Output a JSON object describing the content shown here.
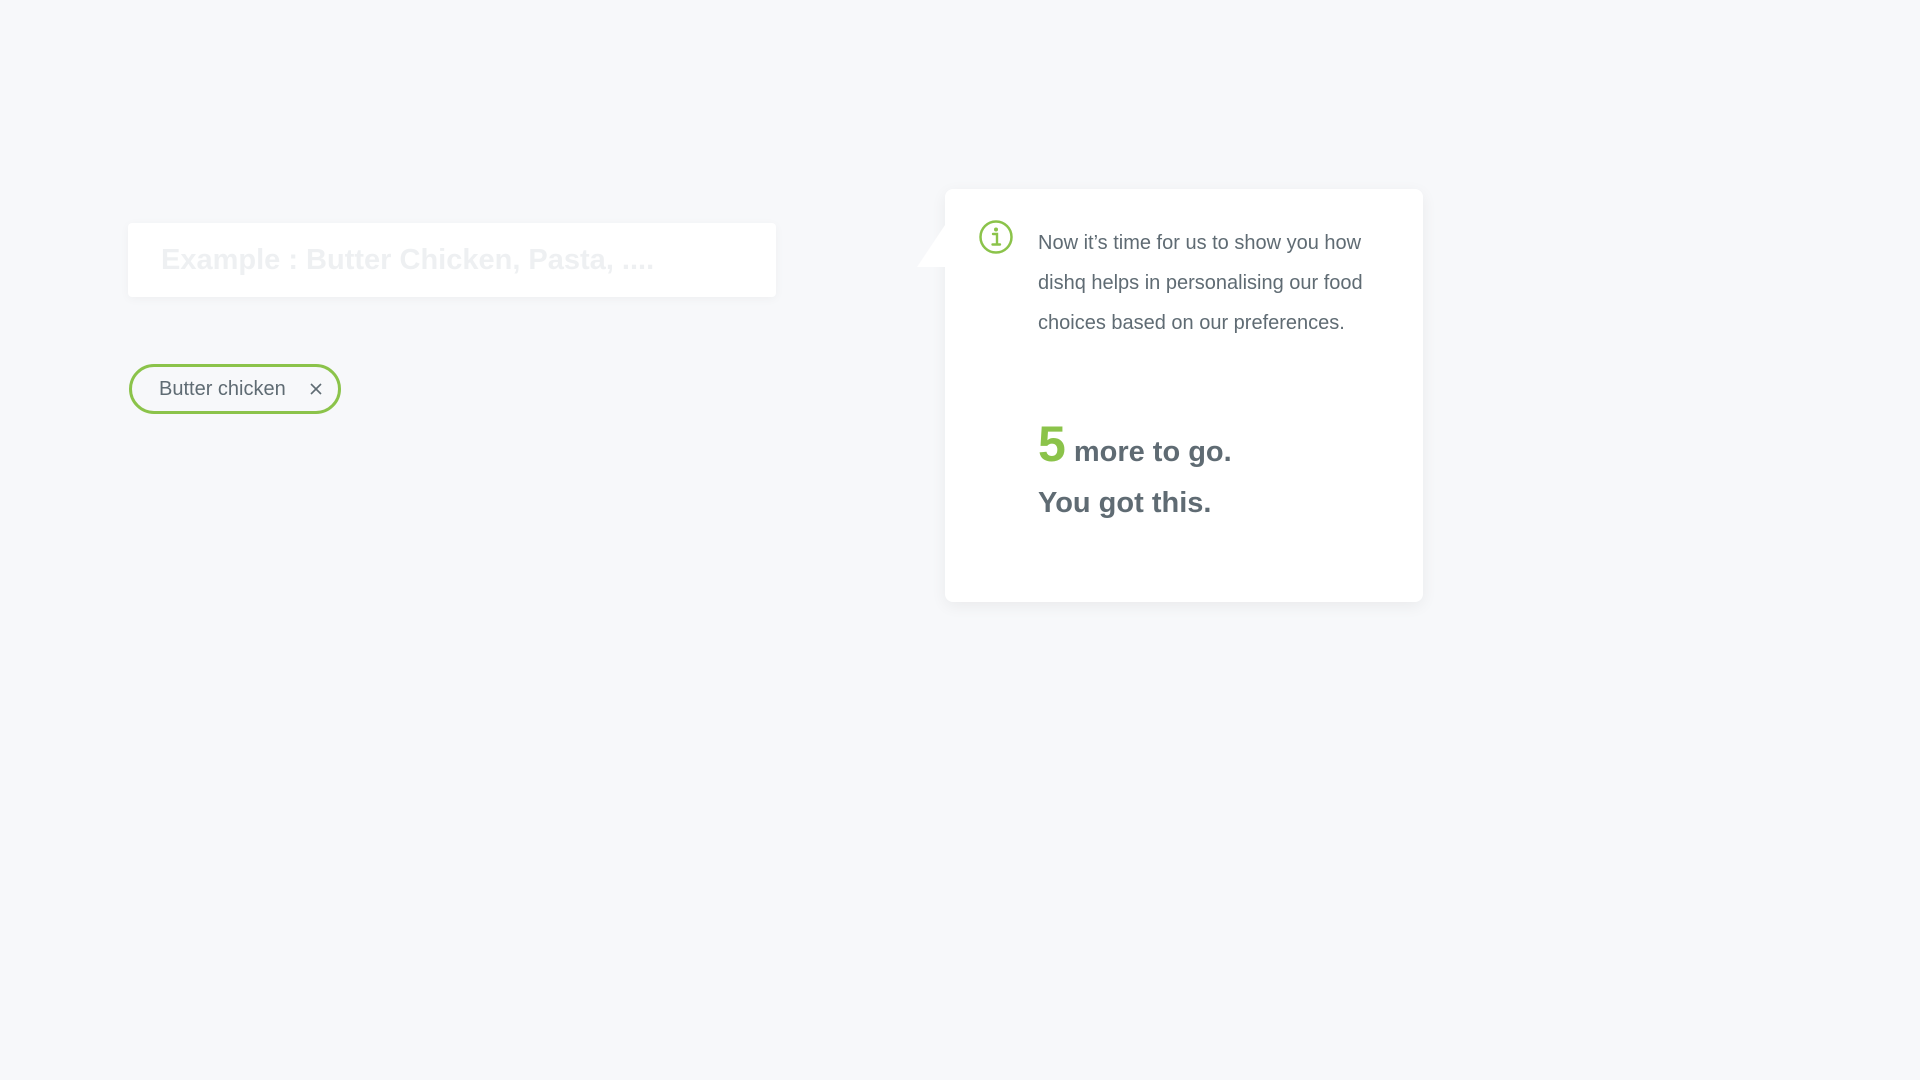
{
  "search": {
    "placeholder": "Example : Butter Chicken, Pasta, ....",
    "value": ""
  },
  "chips": [
    {
      "label": "Butter chicken",
      "icon": "close-icon"
    }
  ],
  "tooltip": {
    "icon": "info-icon",
    "message": "Now it’s time for us to show you how dishq helps in personalising our food choices based on our preferences.",
    "remaining_count": "5",
    "remaining_text": "more to go.",
    "encouragement": "You got this."
  },
  "colors": {
    "accent": "#8bc34a",
    "text": "#5f6b73",
    "background": "#f7f8fa",
    "card": "#ffffff"
  }
}
